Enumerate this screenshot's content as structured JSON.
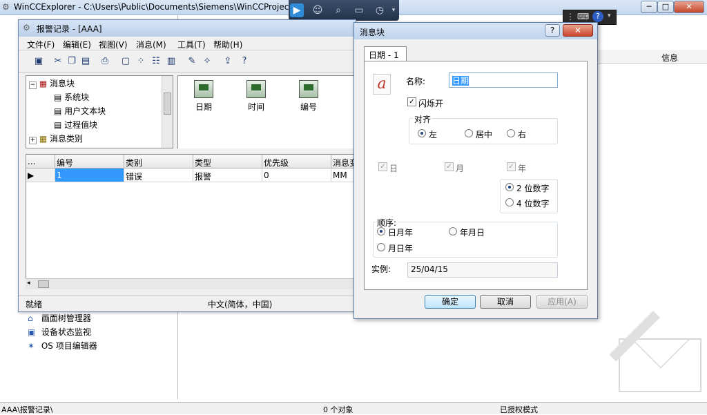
{
  "outer": {
    "title": "WinCCExplorer - C:\\Users\\Public\\Documents\\Siemens\\WinCCProject",
    "right_header_col": "信息",
    "tree_items": [
      "画面树管理器",
      "设备状态监视",
      "OS 项目编辑器"
    ],
    "status": {
      "path": "AAA\\报警记录\\",
      "objects": "0 个对象",
      "mode": "已授权模式"
    },
    "controls": {
      "minimize": "─",
      "maximize": "□",
      "close": "✕"
    }
  },
  "remote_toolbar": {
    "icons": [
      "play-icon",
      "user-icon",
      "search-icon",
      "screen-icon",
      "clock-icon",
      "dropdown-icon"
    ]
  },
  "alarm_window": {
    "title": "报警记录 - [AAA]",
    "menu": [
      "文件(F)",
      "编辑(E)",
      "视图(V)",
      "消息(M)",
      "工具(T)",
      "帮助(H)"
    ],
    "toolbar_icons": [
      "save-icon",
      "cut-icon",
      "copy-icon",
      "paste-icon",
      "print-icon",
      "large-icons-icon",
      "small-icons-icon",
      "list-icon",
      "details-icon",
      "properties-icon",
      "wizard-icon",
      "select-icon",
      "help-icon"
    ],
    "tree": [
      {
        "label": "消息块",
        "level": 0,
        "expand": "−"
      },
      {
        "label": "系统块",
        "level": 1
      },
      {
        "label": "用户文本块",
        "level": 1
      },
      {
        "label": "过程值块",
        "level": 1
      },
      {
        "label": "消息类别",
        "level": 0,
        "expand": "+"
      }
    ],
    "icons": [
      "日期",
      "时间",
      "编号"
    ],
    "grid": {
      "headers": [
        "...",
        "编号",
        "类别",
        "类型",
        "优先级",
        "消息变"
      ],
      "rows": [
        [
          "",
          "1",
          "错误",
          "报警",
          "0",
          "MM"
        ]
      ]
    },
    "status_left": "就绪",
    "status_center": "中文(简体，中国)"
  },
  "dialog": {
    "title": "消息块",
    "help_label": "?",
    "close_label": "✕",
    "tab": "日期 - 1",
    "name_label": "名称:",
    "name_value": "日期",
    "blink_label": "闪烁开",
    "blink_checked": true,
    "align": {
      "title": "对齐",
      "options": [
        "左",
        "居中",
        "右"
      ],
      "selected": "左"
    },
    "parts": [
      {
        "label": "日",
        "checked": true
      },
      {
        "label": "月",
        "checked": true
      },
      {
        "label": "年",
        "checked": true
      }
    ],
    "year_digits": {
      "options": [
        "2 位数字",
        "4 位数字"
      ],
      "selected": "2 位数字"
    },
    "order": {
      "title": "顺序:",
      "options": [
        "日月年",
        "年月日",
        "月日年"
      ],
      "selected": "日月年"
    },
    "example_label": "实例:",
    "example_value": "25/04/15",
    "buttons": {
      "ok": "确定",
      "cancel": "取消",
      "apply": "应用(A)"
    }
  }
}
